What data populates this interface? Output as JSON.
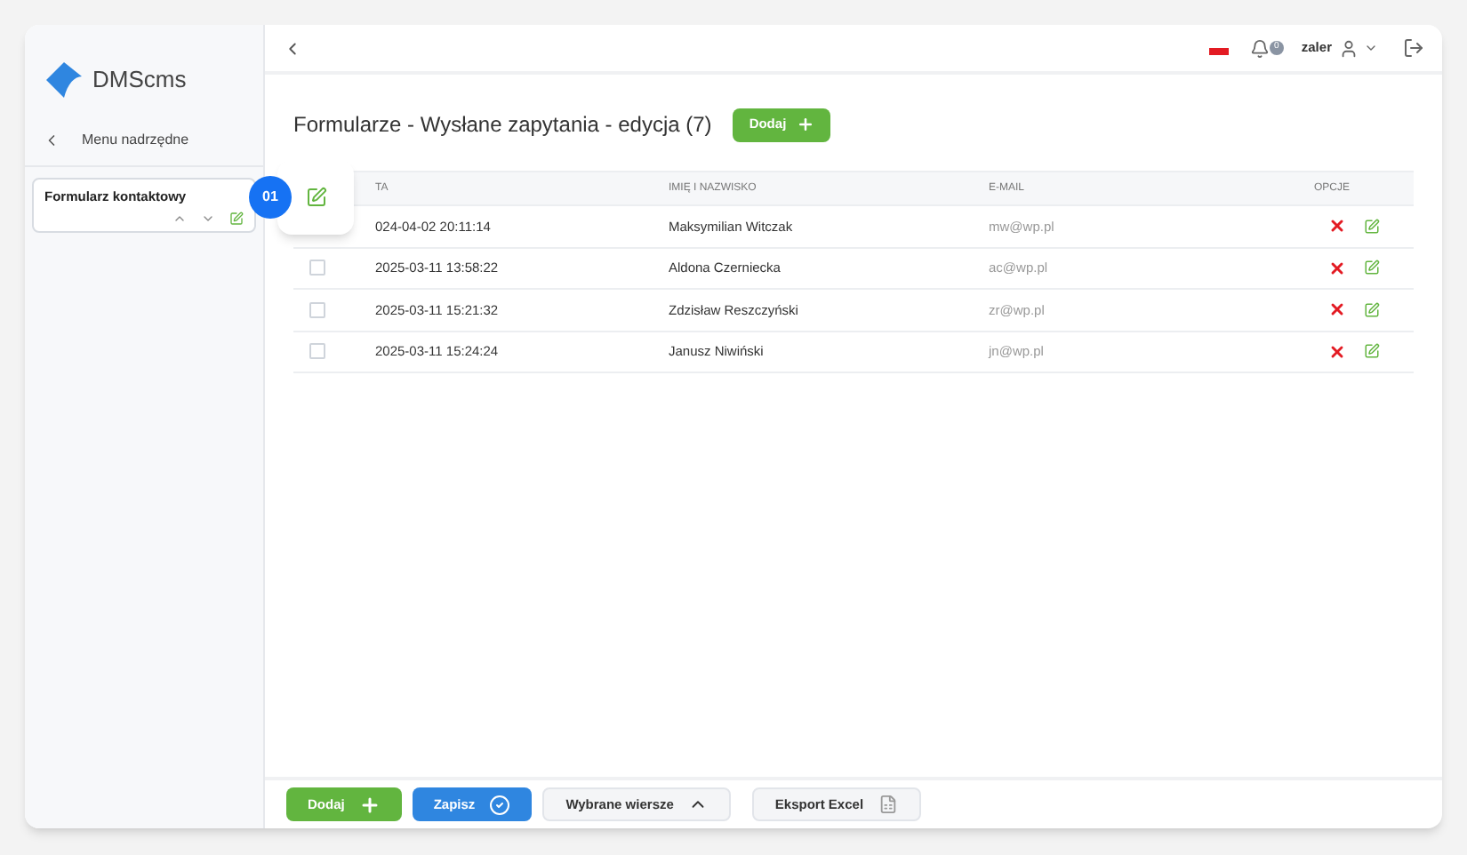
{
  "brand": {
    "name": "DMScms"
  },
  "sidebar": {
    "back_label": "Menu nadrzędne",
    "items": [
      {
        "label": "Formularz kontaktowy",
        "selected": true
      }
    ]
  },
  "callout": {
    "number": "01"
  },
  "header": {
    "notifications": "0",
    "user": "zaler"
  },
  "page": {
    "title": "Formularze - Wysłane zapytania - edycja (7)",
    "add_button": "Dodaj"
  },
  "table": {
    "columns": [
      "TA",
      "IMIĘ I NAZWISKO",
      "E-MAIL",
      "OPCJE"
    ],
    "rows": [
      {
        "date": "024-04-02 20:11:14",
        "name": "Maksymilian Witczak",
        "email": "mw@wp.pl"
      },
      {
        "checked": false,
        "date": "2025-03-11 13:58:22",
        "name": "Aldona Czerniecka",
        "email": "ac@wp.pl"
      },
      {
        "checked": false,
        "date": "2025-03-11 15:21:32",
        "name": "Zdzisław Reszczyński",
        "email": "zr@wp.pl"
      },
      {
        "checked": false,
        "date": "2025-03-11 15:24:24",
        "name": "Janusz Niwiński",
        "email": "jn@wp.pl"
      }
    ]
  },
  "footer": {
    "buttons": [
      {
        "kind": "add",
        "label": "Dodaj"
      },
      {
        "kind": "save",
        "label": "Zapisz"
      },
      {
        "kind": "dropdown",
        "label": "Wybrane wiersze"
      },
      {
        "kind": "export",
        "label": "Eksport Excel"
      }
    ]
  }
}
